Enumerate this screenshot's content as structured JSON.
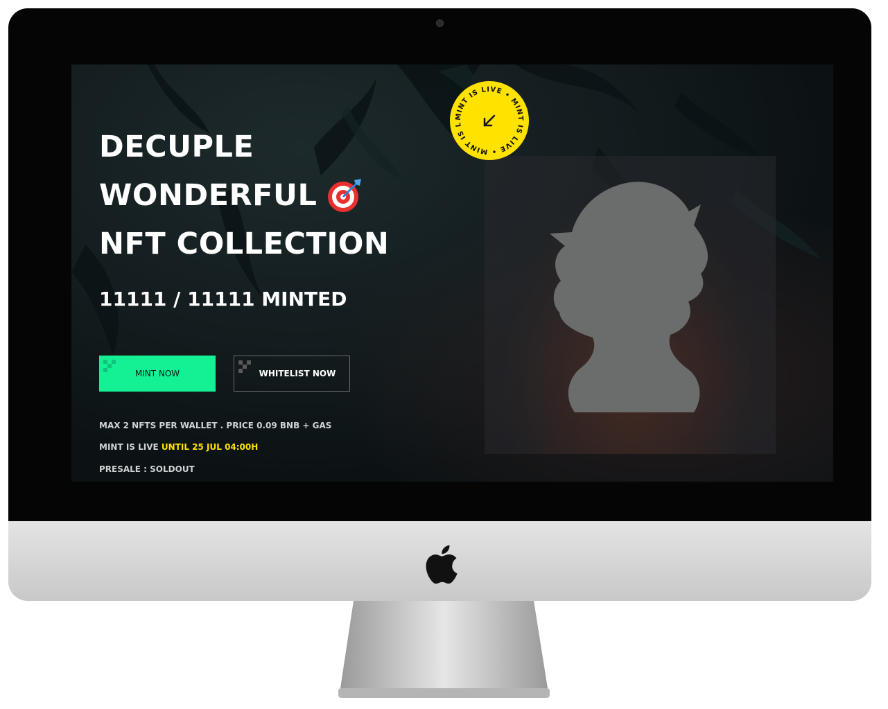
{
  "hero": {
    "title_line1": "DECUPLE",
    "title_line2": "WONDERFUL",
    "title_line3": "NFT COLLECTION",
    "title_icon": "target-icon",
    "minted": "11111 / 11111 MINTED"
  },
  "buttons": {
    "mint": "MINT NOW",
    "whitelist": "WHITELIST NOW"
  },
  "info": {
    "line1": "MAX 2 NFTS PER WALLET . PRICE 0.09 BNB + GAS",
    "line2_prefix": "MINT IS LIVE",
    "line2_highlight": "UNTIL 25 JUL 04:00H",
    "line3": "PRESALE : SOLDOUT"
  },
  "badge": {
    "text": "MINT IS LIVE • MINT IS LIVE • MINT IS LIVE •",
    "icon": "arrow-down-left-icon"
  },
  "colors": {
    "accent": "#14f195",
    "highlight": "#ffe200",
    "badge": "#ffe200"
  }
}
